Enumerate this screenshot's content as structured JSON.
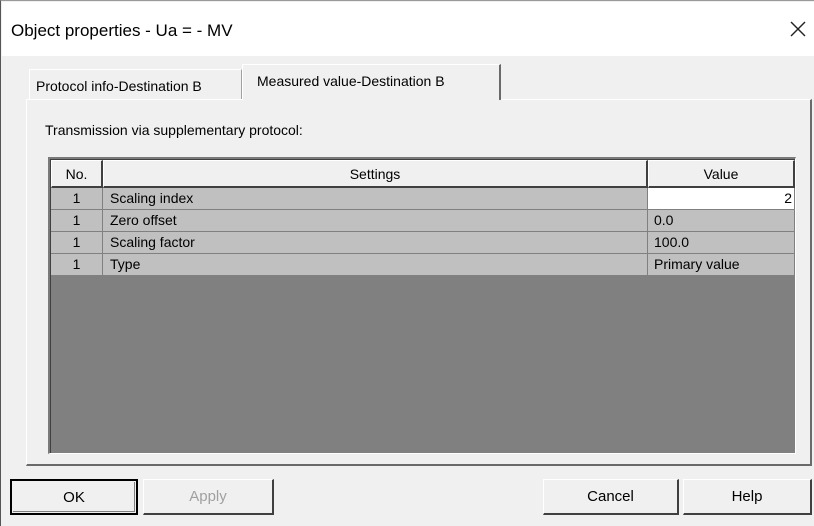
{
  "window": {
    "title": "Object properties - Ua = - MV",
    "close_glyph": "close-icon"
  },
  "tabs": [
    {
      "label": "Protocol info-Destination B",
      "active": false
    },
    {
      "label": "Measured value-Destination B",
      "active": true
    }
  ],
  "panel": {
    "caption": "Transmission via supplementary protocol:"
  },
  "table": {
    "headers": {
      "no": "No.",
      "settings": "Settings",
      "value": "Value"
    },
    "rows": [
      {
        "no": "1",
        "setting": "Scaling index",
        "value": "2"
      },
      {
        "no": "1",
        "setting": "Zero offset",
        "value": "0.0"
      },
      {
        "no": "1",
        "setting": "Scaling factor",
        "value": "100.0"
      },
      {
        "no": "1",
        "setting": "Type",
        "value": "Primary value"
      }
    ]
  },
  "buttons": {
    "ok": "OK",
    "apply": "Apply",
    "cancel": "Cancel",
    "help": "Help"
  }
}
